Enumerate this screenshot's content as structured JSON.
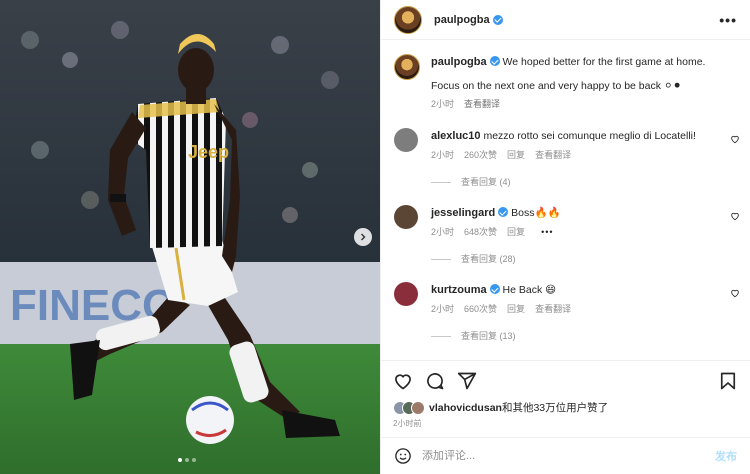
{
  "post": {
    "author": "paulpogba",
    "caption_line1": "We hoped better for the first game at home.",
    "caption_line2": "Focus on the next one and very happy to be back ⚪⚫",
    "caption_time": "2小时",
    "see_translation": "查看翻译"
  },
  "comments": [
    {
      "user": "alexluc10",
      "verified": false,
      "text": "mezzo rotto sei comunque meglio di Locatelli!",
      "time": "2小时",
      "likes": "260次赞",
      "reply": "回复",
      "translate": "查看翻译",
      "view_replies": "查看回复 (4)",
      "avatar_color": "#7d7d7d"
    },
    {
      "user": "jesselingard",
      "verified": true,
      "text": "Boss🔥🔥",
      "time": "2小时",
      "likes": "648次赞",
      "reply": "回复",
      "translate": "",
      "more": "•••",
      "view_replies": "查看回复 (28)",
      "avatar_color": "#5b4636"
    },
    {
      "user": "kurtzouma",
      "verified": true,
      "text": "He Back 😄",
      "time": "2小时",
      "likes": "660次赞",
      "reply": "回复",
      "translate": "查看翻译",
      "view_replies": "查看回复 (13)",
      "avatar_color": "#8a2e3b"
    }
  ],
  "likes_summary": {
    "user": "vlahovicdusan",
    "rest": "和其他33万位用户赞了"
  },
  "post_time": "2小时前",
  "add_comment": {
    "placeholder": "添加评论...",
    "post_label": "发布"
  },
  "icons": [
    "more-icon",
    "heart-icon",
    "comment-icon",
    "share-icon",
    "save-icon",
    "emoji-icon",
    "next-arrow-icon"
  ],
  "colors": {
    "verified": "#3897f0",
    "muted": "#8e8e8e",
    "post_button": "#b2dffc"
  },
  "carousel": {
    "pages": 3,
    "current": 1
  }
}
